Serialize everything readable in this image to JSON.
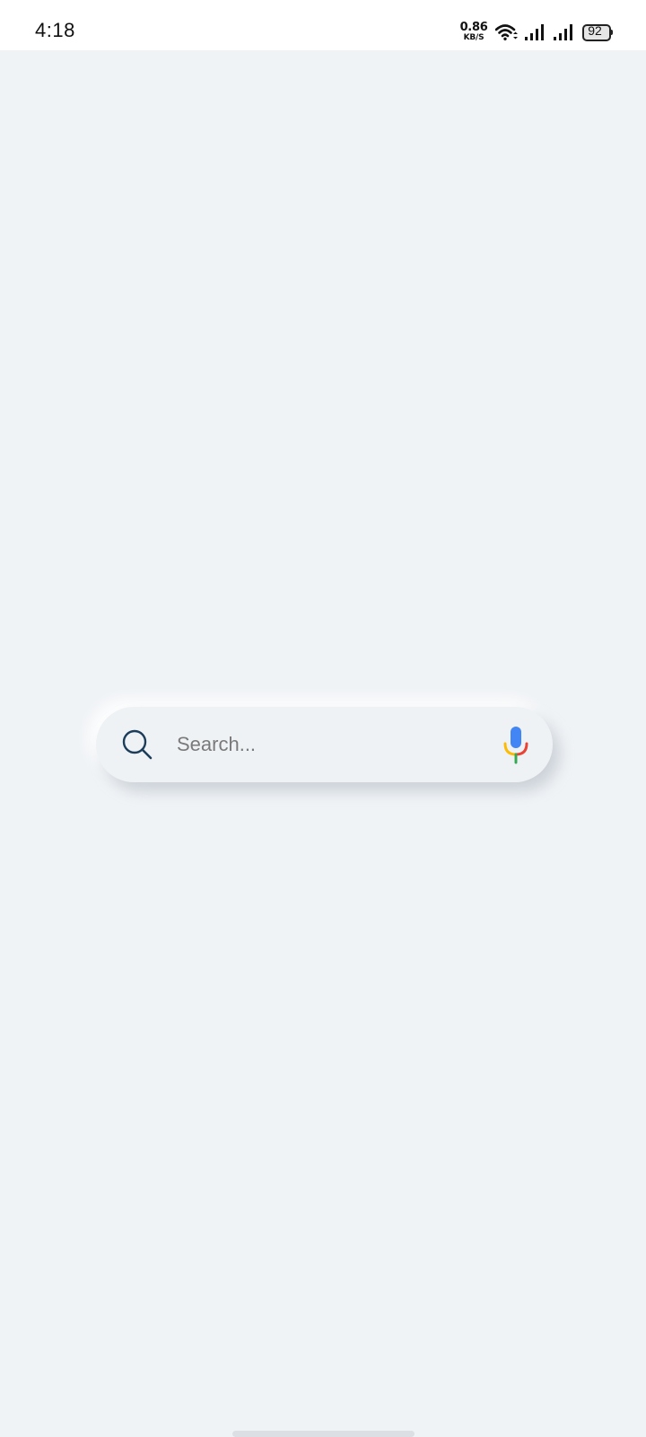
{
  "status_bar": {
    "time": "4:18",
    "net_speed_value": "0.86",
    "net_speed_unit": "KB/S",
    "battery_level": "92",
    "icons": [
      "wifi-icon",
      "signal-icon",
      "signal-icon",
      "battery-icon"
    ]
  },
  "search": {
    "placeholder": "Search...",
    "value": "",
    "left_icon": "search-icon",
    "right_icon": "mic-icon"
  },
  "colors": {
    "background": "#f0f3f6",
    "search_icon": "#1c3d5a",
    "mic_blue": "#4285f4",
    "mic_red": "#ea4335",
    "mic_yellow": "#fbbc05",
    "mic_green": "#34a853"
  }
}
